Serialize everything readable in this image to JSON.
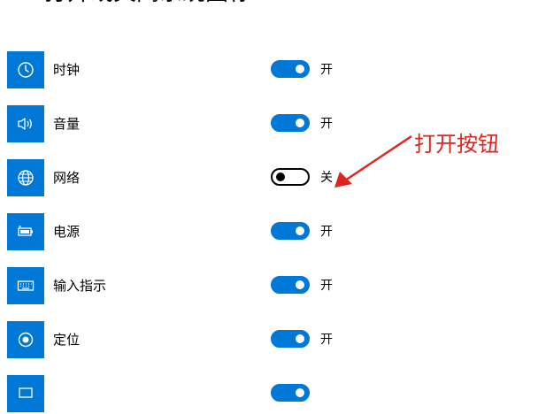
{
  "header": {
    "home_icon": "home-icon",
    "title": "打开或关闭系统图标"
  },
  "rows": [
    {
      "icon": "clock-icon",
      "label": "时钟",
      "on": true,
      "state_label": "开"
    },
    {
      "icon": "volume-icon",
      "label": "音量",
      "on": true,
      "state_label": "开"
    },
    {
      "icon": "globe-icon",
      "label": "网络",
      "on": false,
      "state_label": "关"
    },
    {
      "icon": "battery-icon",
      "label": "电源",
      "on": true,
      "state_label": "开"
    },
    {
      "icon": "keyboard-icon",
      "label": "输入指示",
      "on": true,
      "state_label": "开"
    },
    {
      "icon": "location-icon",
      "label": "定位",
      "on": true,
      "state_label": "开"
    },
    {
      "icon": "window-icon",
      "label": "",
      "on": true,
      "state_label": ""
    }
  ],
  "annotation": {
    "text": "打开按钮",
    "color": "#e0241c"
  },
  "colors": {
    "accent": "#0078d7",
    "annotation": "#e0241c"
  }
}
